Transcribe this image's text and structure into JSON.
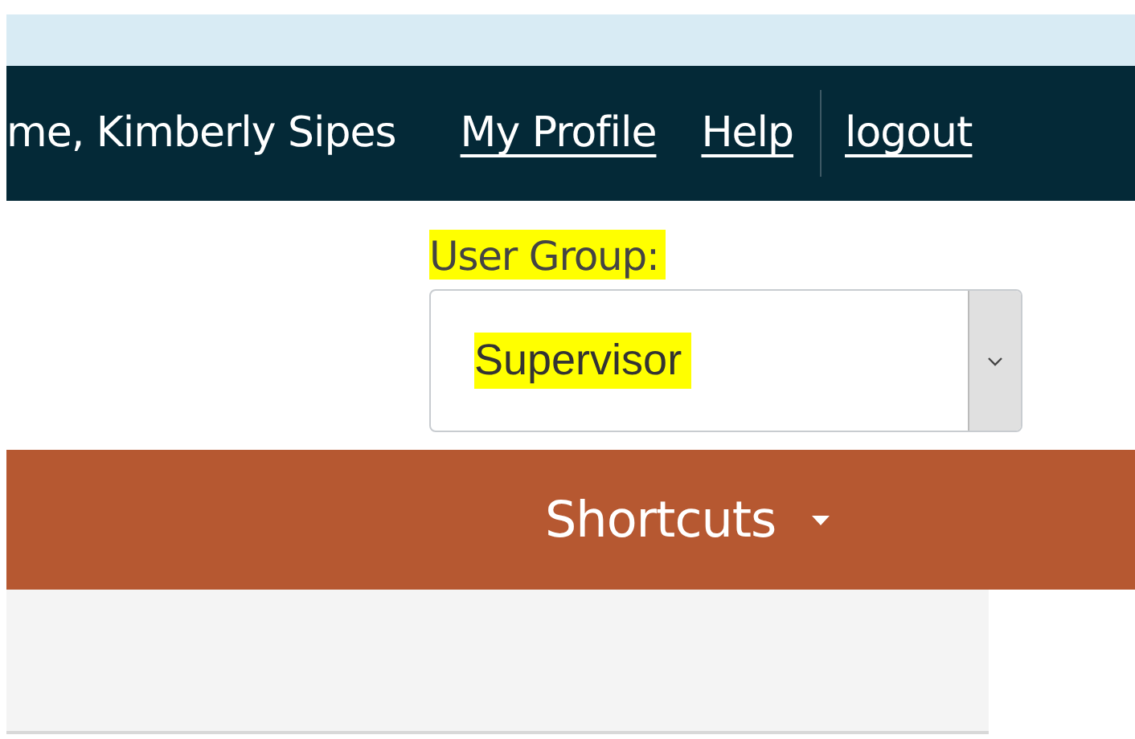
{
  "top_nav": {
    "greeting": "me, Kimberly Sipes",
    "links": [
      {
        "label": "My Profile",
        "divider_before": false
      },
      {
        "label": "Help",
        "divider_before": false
      },
      {
        "label": "logout",
        "divider_before": true
      }
    ]
  },
  "user_group": {
    "label": "User Group:",
    "label_highlighted": true,
    "value": "Supervisor",
    "value_highlighted": true
  },
  "menu_bar": {
    "items": [
      {
        "label": "Shortcuts",
        "kind": "dropdown"
      }
    ]
  }
}
